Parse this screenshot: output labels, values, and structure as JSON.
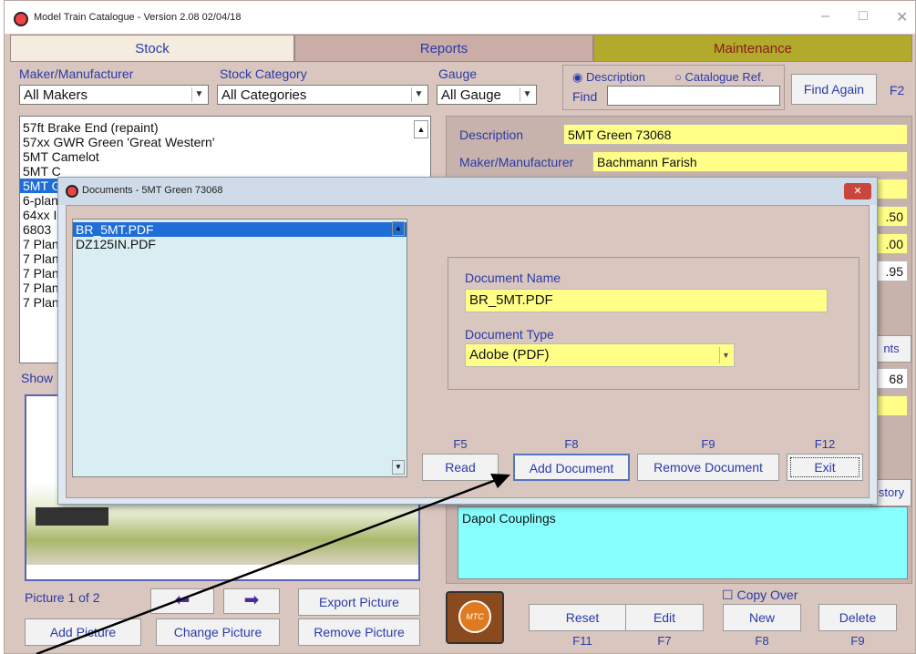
{
  "window": {
    "title": "Model Train Catalogue - Version 2.08 02/04/18",
    "minimize": "–",
    "maximize": "□",
    "close": "✕"
  },
  "tabs": [
    "Stock",
    "Reports",
    "Maintenance"
  ],
  "filters": {
    "maker_label": "Maker/Manufacturer",
    "maker_value": "All Makers",
    "category_label": "Stock Category",
    "category_value": "All Categories",
    "gauge_label": "Gauge",
    "gauge_value": "All Gauge",
    "radio_description": "Description",
    "radio_catalogue": "Catalogue Ref.",
    "find_label": "Find",
    "find_again": "Find Again",
    "find_key": "F2"
  },
  "stock_list": [
    "57ft Brake End (repaint)",
    "57xx GWR Green 'Great Western'",
    "5MT Camelot",
    "5MT C",
    "5MT G",
    "6-plan",
    "64xx I",
    "6803",
    "7 Plan",
    "7 Plan",
    "7 Plan",
    "7 Plan",
    "7 Plan"
  ],
  "show_label": "Show",
  "details": {
    "description_label": "Description",
    "description_value": "5MT Green 73068",
    "maker_label": "Maker/Manufacturer",
    "maker_value": "Bachmann Farish",
    "value1": ".50",
    "value2": ".00",
    "value3": ".95",
    "docs_btn": "nts",
    "num": "68",
    "history_btn": "story",
    "notes": "Dapol Couplings"
  },
  "picture": {
    "counter": "Picture 1 of 2",
    "prev": "⬅",
    "next": "➡",
    "export": "Export Picture",
    "add": "Add Picture",
    "change": "Change Picture",
    "remove": "Remove Picture"
  },
  "actions": {
    "copy_over": "Copy Over",
    "reset": "Reset",
    "reset_key": "F11",
    "edit": "Edit",
    "edit_key": "F7",
    "new": "New",
    "new_key": "F8",
    "delete": "Delete",
    "delete_key": "F9",
    "logo": "MTC"
  },
  "dialog": {
    "title": "Documents - 5MT Green 73068",
    "close": "✕",
    "documents": [
      "BR_5MT.PDF",
      "DZ125IN.PDF"
    ],
    "name_label": "Document Name",
    "name_value": "BR_5MT.PDF",
    "type_label": "Document Type",
    "type_value": "Adobe (PDF)",
    "read": "Read",
    "read_key": "F5",
    "add": "Add Document",
    "add_key": "F8",
    "remove": "Remove Document",
    "remove_key": "F9",
    "exit": "Exit",
    "exit_key": "F12"
  }
}
